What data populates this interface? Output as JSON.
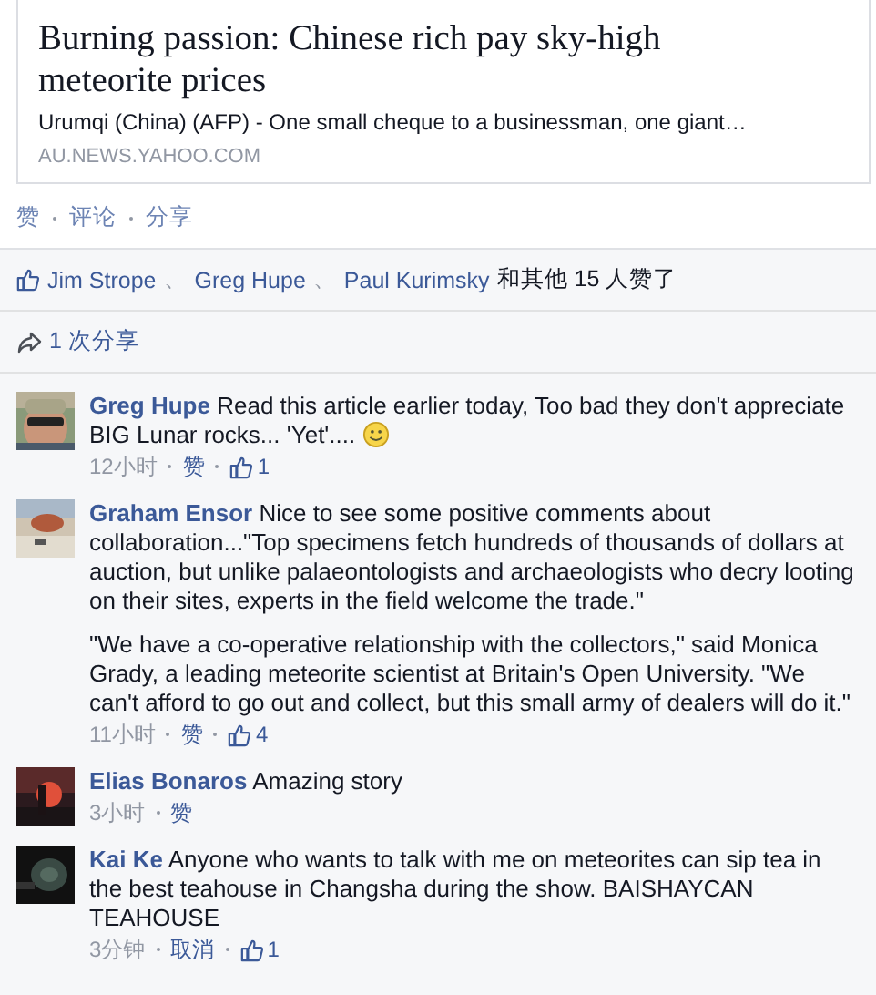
{
  "link_card": {
    "title": "Burning passion: Chinese rich pay sky-high meteorite prices",
    "summary": "Urumqi (China) (AFP) - One small cheque to a businessman, one giant…",
    "domain": "AU.NEWS.YAHOO.COM"
  },
  "post_actions": [
    "赞",
    "评论",
    "分享"
  ],
  "likes": {
    "names": [
      "Jim Strope",
      "Greg Hupe",
      "Paul Kurimsky"
    ],
    "separator": "、",
    "suffix": "和其他 15 人赞了"
  },
  "shares": {
    "label": "1 次分享"
  },
  "comments": [
    {
      "author": "Greg Hupe",
      "paragraphs": [
        "Read this article earlier today, Too bad they don't appreciate BIG Lunar rocks... 'Yet'...."
      ],
      "has_emoticon": true,
      "time": "12小时",
      "action": "赞",
      "like_count": "1"
    },
    {
      "author": "Graham Ensor",
      "paragraphs": [
        "Nice to see some positive comments about collaboration...\"Top specimens fetch hundreds of thousands of dollars at auction, but unlike palaeontologists and archaeologists who decry looting on their sites, experts in the field welcome the trade.\"",
        "\"We have a co-operative relationship with the collectors,\" said Monica Grady, a leading meteorite scientist at Britain's Open University. \"We can't afford to go out and collect, but this small army of dealers will do it.\""
      ],
      "time": "11小时",
      "action": "赞",
      "like_count": "4"
    },
    {
      "author": "Elias Bonaros",
      "paragraphs": [
        "Amazing story"
      ],
      "time": "3小时",
      "action": "赞"
    },
    {
      "author": "Kai Ke",
      "paragraphs": [
        "Anyone who wants to talk with me on meteorites can sip tea in the best teahouse in Changsha during the show. BAISHAYCAN TEAHOUSE"
      ],
      "time": "3分钟",
      "action": "取消",
      "like_count": "1"
    }
  ]
}
